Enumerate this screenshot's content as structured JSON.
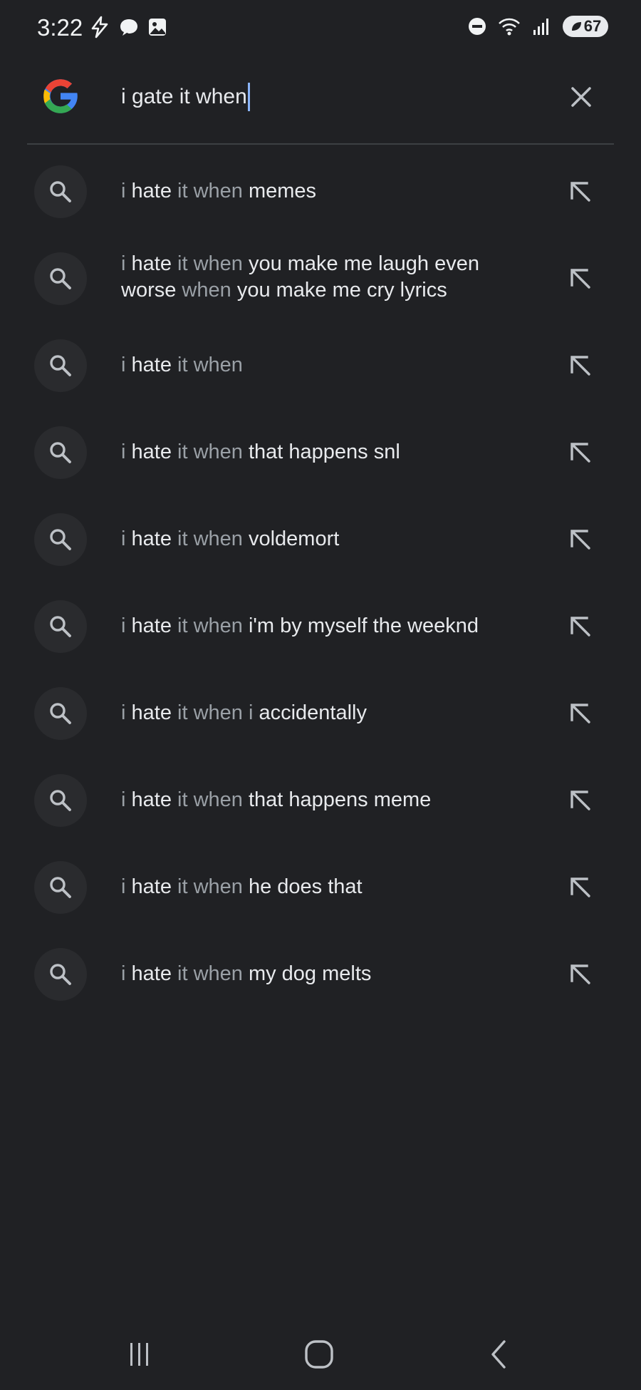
{
  "status_bar": {
    "time": "3:22",
    "battery": "67",
    "icons": [
      "flash-icon",
      "chat-bubble-icon",
      "gallery-icon",
      "do-not-disturb-icon",
      "wifi-icon",
      "signal-icon",
      "battery-icon"
    ]
  },
  "search": {
    "query": "i gate it when",
    "icons": [
      "google-logo",
      "clear-icon"
    ]
  },
  "suggestions": [
    {
      "parts": [
        {
          "t": "i ",
          "s": "m"
        },
        {
          "t": "hate",
          "s": "p"
        },
        {
          "t": " it when ",
          "s": "m"
        },
        {
          "t": "memes",
          "s": "p"
        }
      ]
    },
    {
      "parts": [
        {
          "t": "i ",
          "s": "m"
        },
        {
          "t": "hate",
          "s": "p"
        },
        {
          "t": " it when ",
          "s": "m"
        },
        {
          "t": "you make me laugh even worse",
          "s": "p"
        },
        {
          "t": " when ",
          "s": "m"
        },
        {
          "t": "you make me cry lyrics",
          "s": "p"
        }
      ]
    },
    {
      "parts": [
        {
          "t": "i ",
          "s": "m"
        },
        {
          "t": "hate",
          "s": "p"
        },
        {
          "t": " it when",
          "s": "m"
        }
      ]
    },
    {
      "parts": [
        {
          "t": "i ",
          "s": "m"
        },
        {
          "t": "hate",
          "s": "p"
        },
        {
          "t": " it when ",
          "s": "m"
        },
        {
          "t": "that happens snl",
          "s": "p"
        }
      ]
    },
    {
      "parts": [
        {
          "t": "i ",
          "s": "m"
        },
        {
          "t": "hate",
          "s": "p"
        },
        {
          "t": " it when ",
          "s": "m"
        },
        {
          "t": "voldemort",
          "s": "p"
        }
      ]
    },
    {
      "parts": [
        {
          "t": "i ",
          "s": "m"
        },
        {
          "t": "hate",
          "s": "p"
        },
        {
          "t": " it when ",
          "s": "m"
        },
        {
          "t": "i'm by myself the weeknd",
          "s": "p"
        }
      ]
    },
    {
      "parts": [
        {
          "t": "i ",
          "s": "m"
        },
        {
          "t": "hate",
          "s": "p"
        },
        {
          "t": " it when i ",
          "s": "m"
        },
        {
          "t": "accidentally",
          "s": "p"
        }
      ]
    },
    {
      "parts": [
        {
          "t": "i ",
          "s": "m"
        },
        {
          "t": "hate",
          "s": "p"
        },
        {
          "t": " it when ",
          "s": "m"
        },
        {
          "t": "that happens meme",
          "s": "p"
        }
      ]
    },
    {
      "parts": [
        {
          "t": "i ",
          "s": "m"
        },
        {
          "t": "hate",
          "s": "p"
        },
        {
          "t": " it when ",
          "s": "m"
        },
        {
          "t": "he does that",
          "s": "p"
        }
      ]
    },
    {
      "parts": [
        {
          "t": "i ",
          "s": "m"
        },
        {
          "t": "hate",
          "s": "p"
        },
        {
          "t": " it when ",
          "s": "m"
        },
        {
          "t": "my dog melts",
          "s": "p"
        }
      ]
    }
  ],
  "nav_bar": {
    "icons": [
      "recents-icon",
      "home-icon",
      "back-icon"
    ]
  },
  "colors": {
    "background": "#202124",
    "text_primary": "#e8eaed",
    "text_muted": "#9aa0a6",
    "caret": "#8ab4f8"
  }
}
